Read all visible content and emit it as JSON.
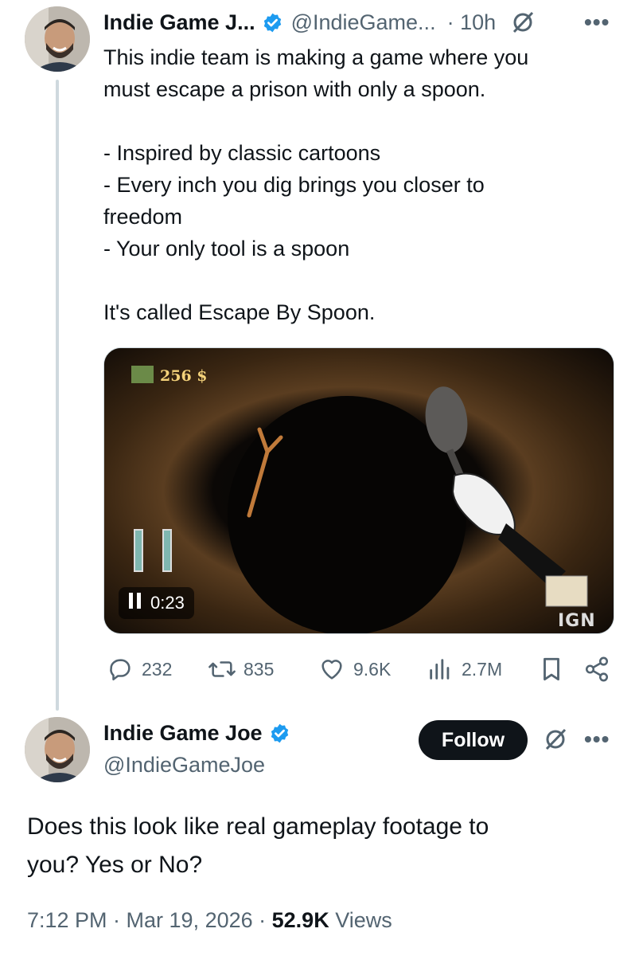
{
  "tweet1": {
    "author_name": "Indie Game J...",
    "author_handle": "@IndieGame...",
    "time": "· 10h",
    "text": "This indie team is making a game where you\nmust escape a prison with only a spoon.\n\n- Inspired by classic cartoons\n- Every inch you dig brings you closer to\nfreedom\n- Your only tool is a spoon\n\nIt's called Escape By Spoon.",
    "video": {
      "hud_money": "256 $",
      "timestamp": "0:23",
      "watermark": "IGN",
      "state": "playing"
    },
    "stats": {
      "replies": "232",
      "reposts": "835",
      "likes": "9.6K",
      "views": "2.7M"
    }
  },
  "tweet2": {
    "author_name": "Indie Game Joe",
    "author_handle": "@IndieGameJoe",
    "follow_label": "Follow",
    "text": "Does this look like real gameplay footage to\nyou? Yes or No?",
    "meta_time": "7:12 PM · Mar 19, 2026 · ",
    "views_count": "52.9K",
    "views_label": " Views"
  },
  "icons": {
    "verified": "verified-badge-icon",
    "grok": "grok-icon",
    "more": "more-icon",
    "reply": "reply-icon",
    "repost": "repost-icon",
    "like": "like-icon",
    "views": "views-icon",
    "bookmark": "bookmark-icon",
    "share": "share-icon",
    "pause": "pause-icon"
  },
  "colors": {
    "verified_blue": "#1d9bf0",
    "text_primary": "#0f1419",
    "text_secondary": "#536471"
  }
}
